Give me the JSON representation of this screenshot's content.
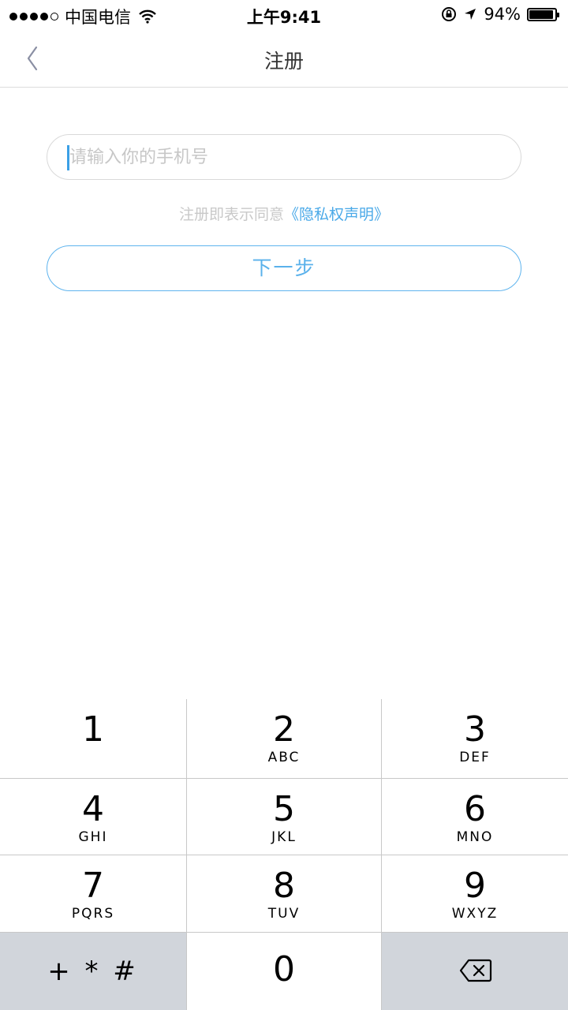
{
  "status_bar": {
    "carrier": "中国电信",
    "time": "上午9:41",
    "battery": "94%",
    "battery_level": 0.94,
    "icons": [
      "signal-dots",
      "wifi-icon",
      "orientation-lock-icon",
      "location-arrow-icon",
      "battery-icon"
    ]
  },
  "nav": {
    "title": "注册",
    "back_icon": "chevron-left-icon"
  },
  "form": {
    "phone_placeholder": "请输入你的手机号",
    "phone_value": "",
    "agreement_prefix": "注册即表示同意",
    "agreement_link": "《隐私权声明》",
    "next_button": "下一步"
  },
  "keypad": {
    "keys": [
      {
        "digit": "1",
        "letters": ""
      },
      {
        "digit": "2",
        "letters": "ABC"
      },
      {
        "digit": "3",
        "letters": "DEF"
      },
      {
        "digit": "4",
        "letters": "GHI"
      },
      {
        "digit": "5",
        "letters": "JKL"
      },
      {
        "digit": "6",
        "letters": "MNO"
      },
      {
        "digit": "7",
        "letters": "PQRS"
      },
      {
        "digit": "8",
        "letters": "TUV"
      },
      {
        "digit": "9",
        "letters": "WXYZ"
      }
    ],
    "symbols": "+ * #",
    "zero": "0",
    "delete_icon": "backspace-icon"
  },
  "colors": {
    "accent": "#4aa9e8",
    "keypad_gray": "#d1d5db"
  }
}
